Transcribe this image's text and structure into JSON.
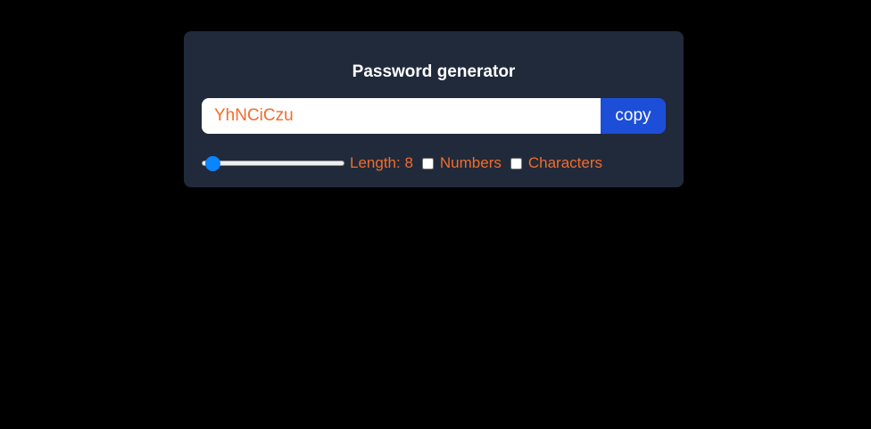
{
  "app": {
    "title": "Password generator"
  },
  "password": {
    "value": "YhNCiCzu"
  },
  "actions": {
    "copy_label": "copy"
  },
  "length": {
    "label": "Length: 8",
    "value": 8,
    "min": 6,
    "max": 100
  },
  "options": {
    "numbers_label": "Numbers",
    "numbers_checked": false,
    "characters_label": "Characters",
    "characters_checked": false
  },
  "colors": {
    "background": "#000000",
    "card": "#212a3a",
    "accent_text": "#f26c2b",
    "button": "#1d4ed8",
    "slider_thumb": "#0a84ff"
  }
}
